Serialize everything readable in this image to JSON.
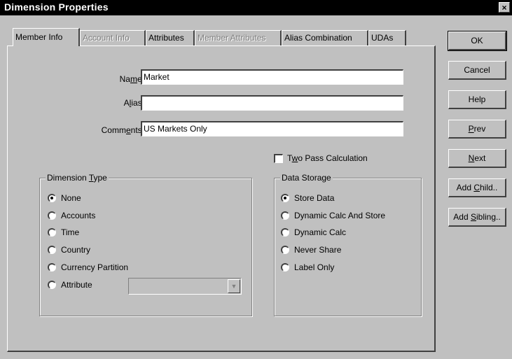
{
  "window": {
    "title": "Dimension Properties",
    "close_glyph": "×"
  },
  "tabs": [
    {
      "label": "Member Info",
      "state": "active"
    },
    {
      "label": "Account Info",
      "state": "disabled"
    },
    {
      "label": "Attributes",
      "state": "enabled"
    },
    {
      "label": "Member Attributes",
      "state": "disabled"
    },
    {
      "label": "Alias Combination",
      "state": "enabled"
    },
    {
      "label": "UDAs",
      "state": "enabled"
    }
  ],
  "fields": {
    "name": {
      "label_pre": "Na",
      "label_ul": "m",
      "label_post": "e:",
      "value": "Market"
    },
    "alias": {
      "label_pre": "A",
      "label_ul": "l",
      "label_post": "ias:",
      "value": ""
    },
    "comments": {
      "label_pre": "Comm",
      "label_ul": "e",
      "label_post": "nts:",
      "value": "US Markets Only"
    }
  },
  "two_pass": {
    "label_pre": "T",
    "label_ul": "w",
    "label_post": "o Pass Calculation",
    "checked": false
  },
  "dimension_type": {
    "legend_pre": "Dimension ",
    "legend_ul": "T",
    "legend_post": "ype",
    "options": [
      "None",
      "Accounts",
      "Time",
      "Country",
      "Currency Partition",
      "Attribute"
    ],
    "selected": "None",
    "attribute_combo_value": ""
  },
  "data_storage": {
    "legend": "Data Storage",
    "options": [
      "Store Data",
      "Dynamic Calc And Store",
      "Dynamic Calc",
      "Never Share",
      "Label Only"
    ],
    "selected": "Store Data"
  },
  "buttons": {
    "ok": "OK",
    "cancel": "Cancel",
    "help": "Help",
    "prev": {
      "ul": "P",
      "post": "rev"
    },
    "next": {
      "ul": "N",
      "post": "ext"
    },
    "add_child": {
      "pre": "Add ",
      "ul": "C",
      "post": "hild.."
    },
    "add_sibling": {
      "pre": "Add ",
      "ul": "S",
      "post": "ibling.."
    }
  }
}
